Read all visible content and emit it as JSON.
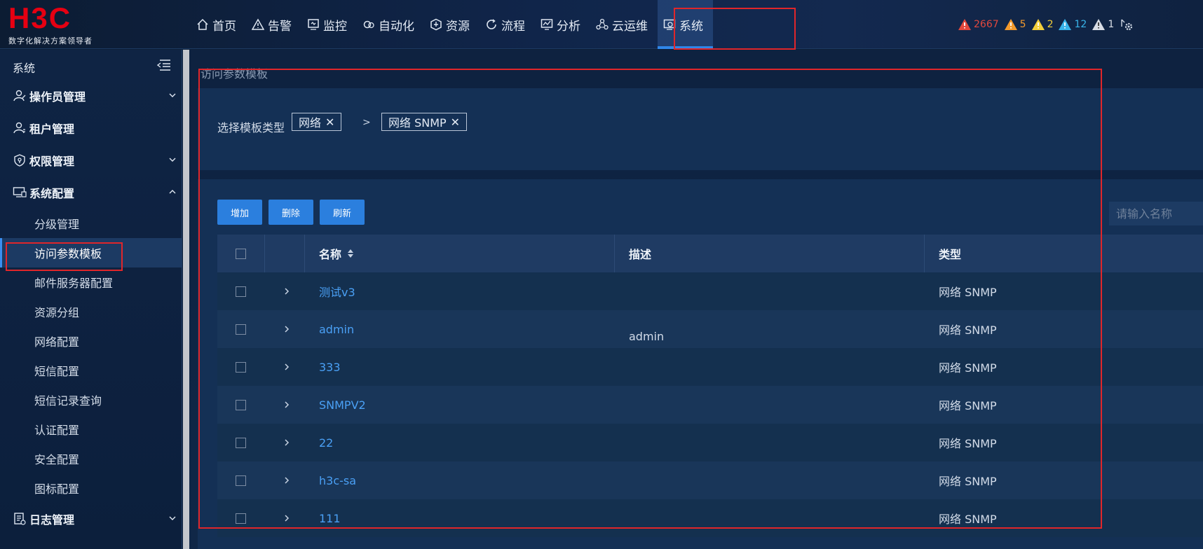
{
  "brand": {
    "logo_text": "H3C",
    "tagline": "数字化解决方案领导者",
    "logo_color": "#e60012"
  },
  "nav": {
    "items": [
      {
        "label": "首页",
        "icon": "home-icon"
      },
      {
        "label": "告警",
        "icon": "alert-icon"
      },
      {
        "label": "监控",
        "icon": "monitor-icon"
      },
      {
        "label": "自动化",
        "icon": "automation-icon"
      },
      {
        "label": "资源",
        "icon": "resource-icon"
      },
      {
        "label": "流程",
        "icon": "process-icon"
      },
      {
        "label": "分析",
        "icon": "analysis-icon"
      },
      {
        "label": "云运维",
        "icon": "cloud-ops-icon"
      },
      {
        "label": "系统",
        "icon": "system-icon",
        "active": true
      }
    ]
  },
  "alarms": [
    {
      "count": "2667",
      "color": "#e2483d",
      "icon": "critical-alarm-icon"
    },
    {
      "count": "5",
      "color": "#f39a2c",
      "icon": "major-alarm-icon"
    },
    {
      "count": "2",
      "color": "#f2cf3a",
      "icon": "minor-alarm-icon"
    },
    {
      "count": "12",
      "color": "#38b4ea",
      "icon": "warning-alarm-icon"
    },
    {
      "count": "1",
      "color": "#d8dde5",
      "icon": "info-alarm-icon"
    }
  ],
  "sidebar": {
    "title": "系统",
    "groups": [
      {
        "label": "操作员管理",
        "icon": "operator-icon",
        "expanded": false
      },
      {
        "label": "租户管理",
        "icon": "tenant-icon",
        "expanded": false
      },
      {
        "label": "权限管理",
        "icon": "permission-icon",
        "expanded": false
      },
      {
        "label": "系统配置",
        "icon": "system-config-icon",
        "expanded": true
      },
      {
        "label": "日志管理",
        "icon": "log-icon",
        "expanded": false
      }
    ],
    "sub_items": [
      {
        "label": "分级管理"
      },
      {
        "label": "访问参数模板",
        "active": true
      },
      {
        "label": "邮件服务器配置"
      },
      {
        "label": "资源分组"
      },
      {
        "label": "网络配置"
      },
      {
        "label": "短信配置"
      },
      {
        "label": "短信记录查询"
      },
      {
        "label": "认证配置"
      },
      {
        "label": "安全配置"
      },
      {
        "label": "图标配置"
      }
    ]
  },
  "main": {
    "breadcrumb": "访问参数模板",
    "filter": {
      "label": "选择模板类型",
      "tag1": "网络",
      "separator": ">",
      "tag2": "网络 SNMP",
      "remove_glyph": "✕"
    },
    "toolbar": {
      "add_label": "增加",
      "delete_label": "删除",
      "refresh_label": "刷新",
      "search_placeholder": "请输入名称"
    },
    "table": {
      "columns": {
        "name": "名称",
        "desc": "描述",
        "type": "类型"
      },
      "rows": [
        {
          "name": "测试v3",
          "desc": "",
          "type": "网络 SNMP"
        },
        {
          "name": "admin",
          "desc": "admin",
          "type": "网络 SNMP"
        },
        {
          "name": "333",
          "desc": "",
          "type": "网络 SNMP"
        },
        {
          "name": "SNMPV2",
          "desc": "",
          "type": "网络 SNMP"
        },
        {
          "name": "22",
          "desc": "",
          "type": "网络 SNMP"
        },
        {
          "name": "h3c-sa",
          "desc": "",
          "type": "网络 SNMP"
        },
        {
          "name": "111",
          "desc": "",
          "type": "网络 SNMP"
        }
      ]
    }
  },
  "colors": {
    "accent": "#2b7fde",
    "link": "#4aa0f5",
    "highlight_box": "#e0262a"
  }
}
